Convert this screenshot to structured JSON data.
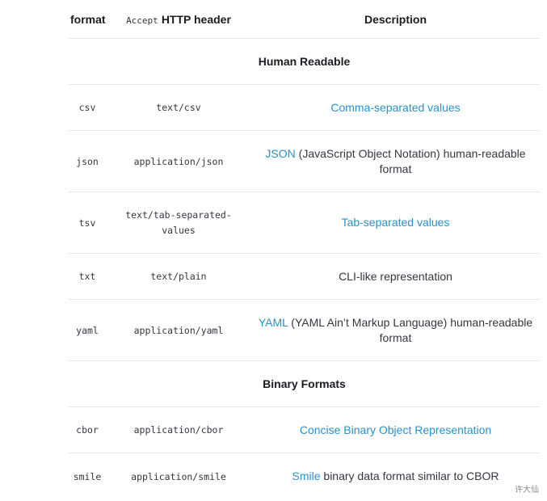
{
  "header": {
    "col_format": "format",
    "col_accept_code": "Accept",
    "col_accept_text": "HTTP header",
    "col_description": "Description"
  },
  "sections": {
    "human_readable": "Human Readable",
    "binary": "Binary Formats"
  },
  "rows": [
    {
      "format": "csv",
      "accept": "text/csv",
      "link": "Comma-separated values",
      "rest": ""
    },
    {
      "format": "json",
      "accept": "application/json",
      "link": "JSON",
      "rest": " (JavaScript Object Notation) human-readable format"
    },
    {
      "format": "tsv",
      "accept_line1": "text/tab-separated-",
      "accept_line2": "values",
      "link": "Tab-separated values",
      "rest": ""
    },
    {
      "format": "txt",
      "accept": "text/plain",
      "link": "",
      "rest": "CLI-like representation"
    },
    {
      "format": "yaml",
      "accept": "application/yaml",
      "link": "YAML",
      "rest": " (YAML Ain’t Markup Language) human-readable format"
    },
    {
      "format": "cbor",
      "accept": "application/cbor",
      "link": "Concise Binary Object Representation",
      "rest": ""
    },
    {
      "format": "smile",
      "accept": "application/smile",
      "link": "Smile",
      "rest": " binary data format similar to CBOR"
    }
  ],
  "watermark": "许大仙",
  "colors": {
    "link": "#2b90c9",
    "text": "#343741",
    "border": "#e6e8ec"
  }
}
